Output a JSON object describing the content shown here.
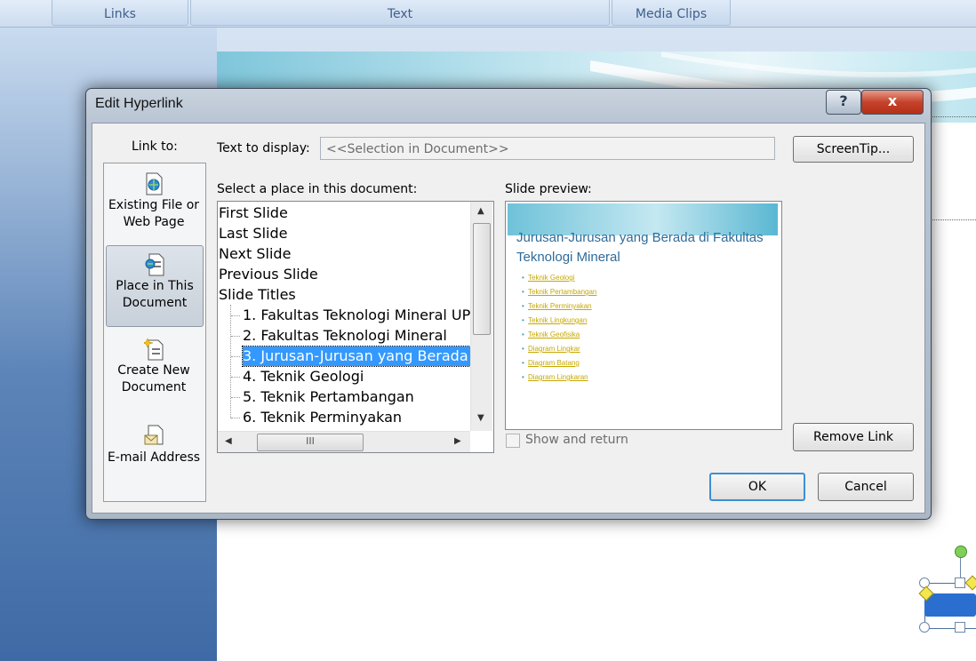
{
  "ribbon": {
    "groups": [
      "Links",
      "Text",
      "Media Clips"
    ]
  },
  "dialog": {
    "title": "Edit Hyperlink",
    "help_label": "?",
    "close_label": "x",
    "link_to_label": "Link to:",
    "link_to_items": [
      {
        "label_line1": "Existing File or",
        "label_line2": "Web Page",
        "icon": "web-page-icon",
        "selected": false
      },
      {
        "label_line1": "Place in This",
        "label_line2": "Document",
        "icon": "place-in-document-icon",
        "selected": true
      },
      {
        "label_line1": "Create New",
        "label_line2": "Document",
        "icon": "new-document-icon",
        "selected": false
      },
      {
        "label_line1": "E-mail Address",
        "label_line2": "",
        "icon": "email-icon",
        "selected": false
      }
    ],
    "text_to_display_label": "Text to display:",
    "text_to_display_value": "<<Selection in Document>>",
    "screentip_label": "ScreenTip...",
    "select_place_label": "Select a place in this document:",
    "places": [
      {
        "label": "First Slide",
        "level": 0
      },
      {
        "label": "Last Slide",
        "level": 0
      },
      {
        "label": "Next Slide",
        "level": 0
      },
      {
        "label": "Previous Slide",
        "level": 0
      },
      {
        "label": "Slide Titles",
        "level": 0
      },
      {
        "label": "1. Fakultas Teknologi Mineral UP",
        "level": 1
      },
      {
        "label": "2. Fakultas Teknologi Mineral",
        "level": 1
      },
      {
        "label": "3. Jurusan-Jurusan yang Berada",
        "level": 1,
        "selected": true
      },
      {
        "label": "4. Teknik Geologi",
        "level": 1
      },
      {
        "label": "5. Teknik Pertambangan",
        "level": 1
      },
      {
        "label": "6. Teknik Perminyakan",
        "level": 1
      }
    ],
    "hscroll_grip": "III",
    "slide_preview_label": "Slide preview:",
    "preview": {
      "title": "Jurusan-Jurusan yang Berada di Fakultas Teknologi Mineral",
      "bullets": [
        "Teknik Geologi",
        "Teknik Pertambangan",
        "Teknik Perminyakan",
        "Teknik Lingkungan",
        "Teknik Geofisika",
        "Diagram Lingkar",
        "Diagram Batang",
        "Diagram Lingkaran"
      ]
    },
    "show_and_return_label": "Show and return",
    "show_and_return_checked": false,
    "remove_link_label": "Remove Link",
    "ok_label": "OK",
    "cancel_label": "Cancel"
  },
  "colors": {
    "selection": "#3399ff",
    "close_button": "#c5432b",
    "preview_bullets": "#c7a800"
  }
}
